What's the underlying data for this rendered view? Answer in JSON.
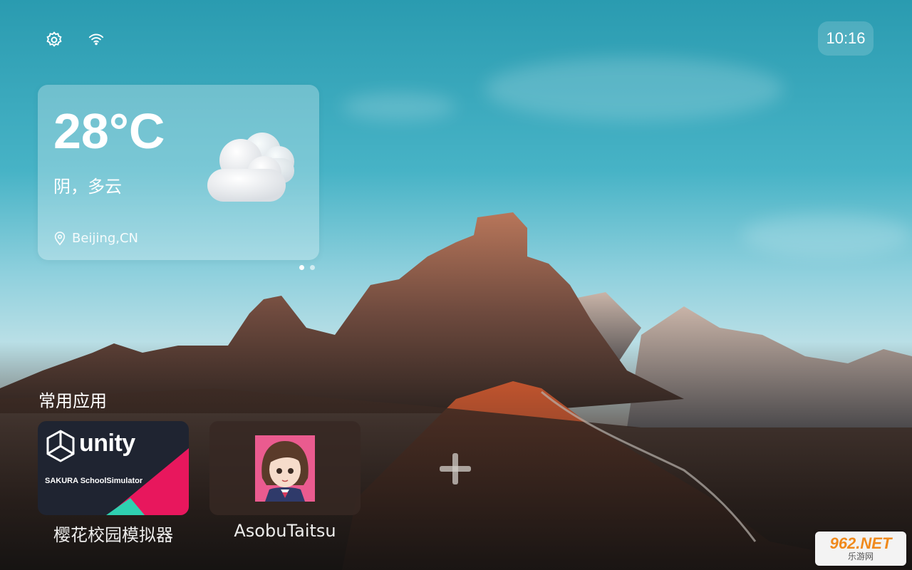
{
  "status_bar": {
    "time": "10:16",
    "icons": [
      "gear-icon",
      "wifi-icon"
    ]
  },
  "weather": {
    "temperature": "28°C",
    "condition": "阴，多云",
    "location": "Beijing,CN",
    "icon": "cloud-icon",
    "page_indicator": {
      "count": 2,
      "active": 1
    }
  },
  "apps_section": {
    "title": "常用应用",
    "apps": [
      {
        "name": "樱花校园模拟器",
        "tile_logo_text": "unity",
        "tile_caption": "SAKURA SchoolSimulator"
      },
      {
        "name": "AsobuTaitsu"
      }
    ],
    "add_icon": "plus-icon"
  },
  "watermark": {
    "text": "962.NET",
    "subtext": "乐游网"
  },
  "colors": {
    "sky_top": "#2a9bb0",
    "unity_tile": "#1f2431",
    "unity_accent_pink": "#e8175d",
    "unity_accent_teal": "#2fd0b0"
  }
}
